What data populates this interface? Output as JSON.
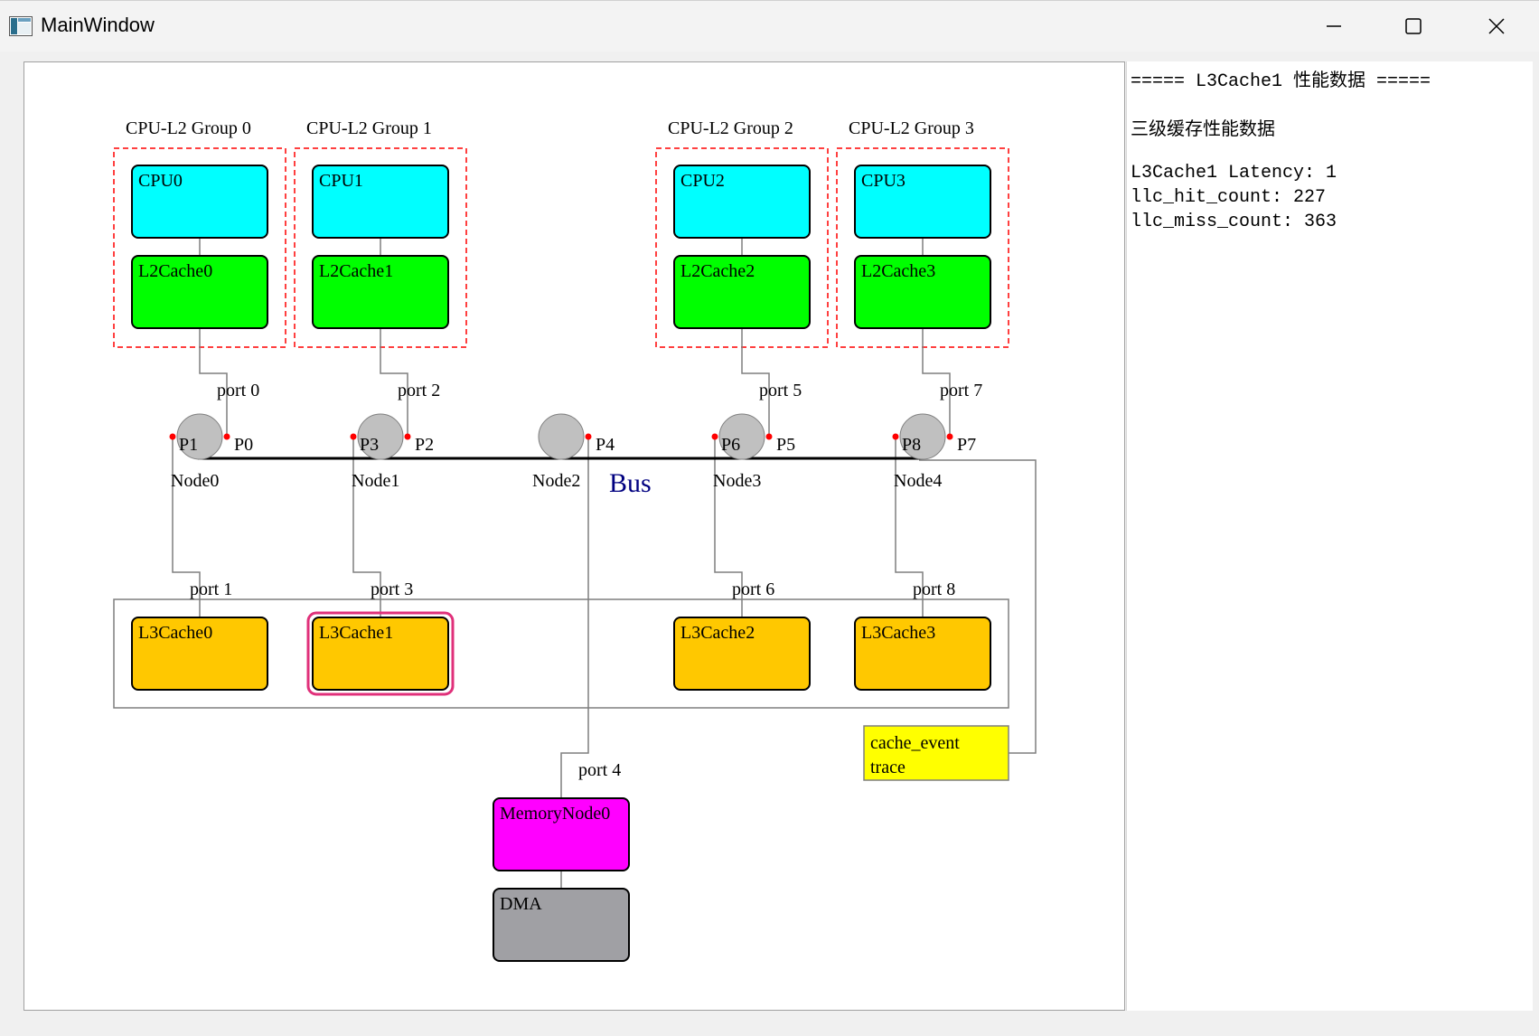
{
  "window": {
    "title": "MainWindow",
    "controls": [
      "minimize",
      "maximize",
      "close"
    ]
  },
  "diagram": {
    "groups": [
      {
        "label": "CPU-L2 Group 0",
        "cpu": "CPU0",
        "l2": "L2Cache0"
      },
      {
        "label": "CPU-L2 Group 1",
        "cpu": "CPU1",
        "l2": "L2Cache1"
      },
      {
        "label": "CPU-L2 Group 2",
        "cpu": "CPU2",
        "l2": "L2Cache2"
      },
      {
        "label": "CPU-L2 Group 3",
        "cpu": "CPU3",
        "l2": "L2Cache3"
      }
    ],
    "ports": [
      "port 0",
      "port 1",
      "port 2",
      "port 3",
      "port 4",
      "port 5",
      "port 6",
      "port 7",
      "port 8"
    ],
    "nodes": [
      {
        "name": "Node0",
        "pins": [
          "P1",
          "P0"
        ]
      },
      {
        "name": "Node1",
        "pins": [
          "P3",
          "P2"
        ]
      },
      {
        "name": "Node2",
        "pins": [
          "P4"
        ]
      },
      {
        "name": "Node3",
        "pins": [
          "P6",
          "P5"
        ]
      },
      {
        "name": "Node4",
        "pins": [
          "P8",
          "P7"
        ]
      }
    ],
    "bus_label": "Bus",
    "l3": [
      "L3Cache0",
      "L3Cache1",
      "L3Cache2",
      "L3Cache3"
    ],
    "selected_l3": "L3Cache1",
    "memory": "MemoryNode0",
    "dma": "DMA",
    "trace_lines": [
      "cache_event",
      "trace"
    ],
    "colors": {
      "cpu": "#00ffff",
      "l2": "#00ff00",
      "l3": "#ffc800",
      "memory": "#ff00ff",
      "dma": "#a0a0a4",
      "trace": "#ffff00",
      "node": "#c0c0c0",
      "pin": "#ff0000",
      "group_border": "#ff0000",
      "selection": "#e0307a",
      "bus_label": "#000080"
    }
  },
  "info_panel": {
    "header": "===== L3Cache1 性能数据 =====",
    "subtitle": "三级缓存性能数据",
    "latency": "L3Cache1 Latency: 1",
    "hit": "llc_hit_count: 227",
    "miss": "llc_miss_count: 363"
  }
}
